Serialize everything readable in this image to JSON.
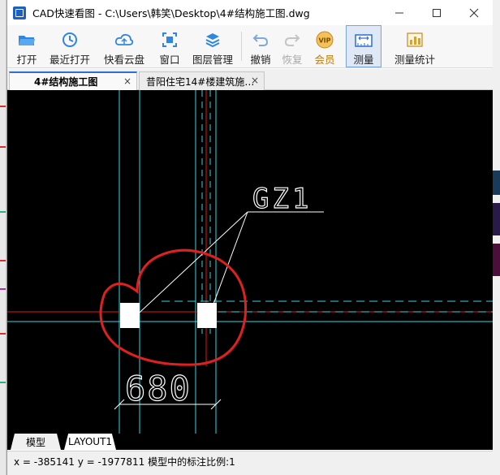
{
  "window": {
    "title": "CAD快速看图 - C:\\Users\\韩笑\\Desktop\\4#结构施工图.dwg",
    "minimize_icon": "minimize-icon",
    "maximize_icon": "maximize-icon",
    "close_icon": "close-icon"
  },
  "toolbar": {
    "items": [
      {
        "label": "打开",
        "icon": "folder-open-icon"
      },
      {
        "label": "最近打开",
        "icon": "clock-icon"
      },
      {
        "label": "快看云盘",
        "icon": "cloud-icon"
      },
      {
        "label": "窗口",
        "icon": "window-icon"
      },
      {
        "label": "图层管理",
        "icon": "layers-icon"
      },
      {
        "label": "撤销",
        "icon": "undo-icon"
      },
      {
        "label": "恢复",
        "icon": "redo-icon"
      },
      {
        "label": "会员",
        "icon": "vip-icon",
        "badge": "VIP"
      },
      {
        "label": "测量",
        "icon": "measure-icon"
      },
      {
        "label": "测量统计",
        "icon": "measure-stats-icon"
      }
    ]
  },
  "tabs": [
    {
      "label": "4#结构施工图",
      "active": true
    },
    {
      "label": "昔阳住宅14#楼建筑施…",
      "active": false
    }
  ],
  "tab_close_glyph": "×",
  "drawing": {
    "label_gz": "GZ1",
    "dimension": "680"
  },
  "layout_tabs": {
    "model": "模型",
    "layout1": "LAYOUT1"
  },
  "status": {
    "text": "x = -385141 y = -1977811 模型中的标注比例:1"
  },
  "colors": {
    "canvas": "#000000",
    "cyan_line": "#33d6e0",
    "red_line": "#e01818",
    "annotation_circle": "#e02020",
    "accent": "#2f6fd0"
  }
}
